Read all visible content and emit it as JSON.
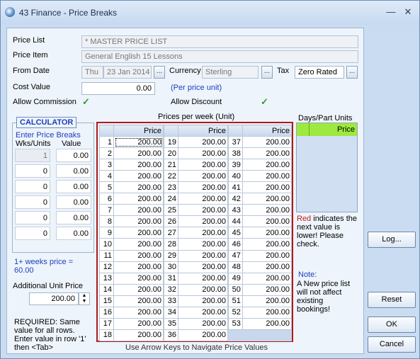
{
  "window": {
    "title": "43 Finance - Price Breaks"
  },
  "form": {
    "price_list_label": "Price List",
    "price_list_value": "* MASTER PRICE LIST",
    "price_item_label": "Price Item",
    "price_item_value": "General English 15 Lessons",
    "from_date_label": "From Date",
    "from_date_day": "Thu",
    "from_date_value": "23 Jan 2014",
    "currency_label": "Currency",
    "currency_value": "Sterling",
    "tax_label": "Tax",
    "tax_value": "Zero Rated",
    "cost_value_label": "Cost Value",
    "cost_value": "0.00",
    "cost_value_unit": "(Per price unit)",
    "allow_commission_label": "Allow Commission",
    "allow_discount_label": "Allow Discount",
    "ellipsis": "..."
  },
  "calculator": {
    "title": "CALCULATOR",
    "subtitle": "Enter Price Breaks",
    "col_weeks": "Wks/Units",
    "col_value": "Value",
    "rows": [
      {
        "weeks": "1",
        "value": "0.00"
      },
      {
        "weeks": "0",
        "value": "0.00"
      },
      {
        "weeks": "0",
        "value": "0.00"
      },
      {
        "weeks": "0",
        "value": "0.00"
      },
      {
        "weeks": "0",
        "value": "0.00"
      },
      {
        "weeks": "0",
        "value": "0.00"
      }
    ],
    "summary": "1+ weeks price = 60.00",
    "additional_unit_label": "Additional Unit Price",
    "additional_unit_value": "200.00",
    "required_text": "REQUIRED: Same value for all rows.  Enter value in row '1' then <Tab>"
  },
  "prices": {
    "title": "Prices per week (Unit)",
    "col_header": "Price",
    "hint": "Use Arrow Keys to Navigate Price Values",
    "col1": [
      {
        "n": "1",
        "v": "200.00"
      },
      {
        "n": "2",
        "v": "200.00"
      },
      {
        "n": "3",
        "v": "200.00"
      },
      {
        "n": "4",
        "v": "200.00"
      },
      {
        "n": "5",
        "v": "200.00"
      },
      {
        "n": "6",
        "v": "200.00"
      },
      {
        "n": "7",
        "v": "200.00"
      },
      {
        "n": "8",
        "v": "200.00"
      },
      {
        "n": "9",
        "v": "200.00"
      },
      {
        "n": "10",
        "v": "200.00"
      },
      {
        "n": "11",
        "v": "200.00"
      },
      {
        "n": "12",
        "v": "200.00"
      },
      {
        "n": "13",
        "v": "200.00"
      },
      {
        "n": "14",
        "v": "200.00"
      },
      {
        "n": "15",
        "v": "200.00"
      },
      {
        "n": "16",
        "v": "200.00"
      },
      {
        "n": "17",
        "v": "200.00"
      },
      {
        "n": "18",
        "v": "200.00"
      }
    ],
    "col2": [
      {
        "n": "19",
        "v": "200.00"
      },
      {
        "n": "20",
        "v": "200.00"
      },
      {
        "n": "21",
        "v": "200.00"
      },
      {
        "n": "22",
        "v": "200.00"
      },
      {
        "n": "23",
        "v": "200.00"
      },
      {
        "n": "24",
        "v": "200.00"
      },
      {
        "n": "25",
        "v": "200.00"
      },
      {
        "n": "26",
        "v": "200.00"
      },
      {
        "n": "27",
        "v": "200.00"
      },
      {
        "n": "28",
        "v": "200.00"
      },
      {
        "n": "29",
        "v": "200.00"
      },
      {
        "n": "30",
        "v": "200.00"
      },
      {
        "n": "31",
        "v": "200.00"
      },
      {
        "n": "32",
        "v": "200.00"
      },
      {
        "n": "33",
        "v": "200.00"
      },
      {
        "n": "34",
        "v": "200.00"
      },
      {
        "n": "35",
        "v": "200.00"
      },
      {
        "n": "36",
        "v": "200.00"
      }
    ],
    "col3": [
      {
        "n": "37",
        "v": "200.00"
      },
      {
        "n": "38",
        "v": "200.00"
      },
      {
        "n": "39",
        "v": "200.00"
      },
      {
        "n": "40",
        "v": "200.00"
      },
      {
        "n": "41",
        "v": "200.00"
      },
      {
        "n": "42",
        "v": "200.00"
      },
      {
        "n": "43",
        "v": "200.00"
      },
      {
        "n": "44",
        "v": "200.00"
      },
      {
        "n": "45",
        "v": "200.00"
      },
      {
        "n": "46",
        "v": "200.00"
      },
      {
        "n": "47",
        "v": "200.00"
      },
      {
        "n": "48",
        "v": "200.00"
      },
      {
        "n": "49",
        "v": "200.00"
      },
      {
        "n": "50",
        "v": "200.00"
      },
      {
        "n": "51",
        "v": "200.00"
      },
      {
        "n": "52",
        "v": "200.00"
      },
      {
        "n": "53",
        "v": "200.00"
      }
    ]
  },
  "days": {
    "title": "Days/Part Units",
    "col_header": "Price",
    "red_word": "Red",
    "red_note": " indicates the next value is lower!  Please check.",
    "note_title": "Note:",
    "note_text": "A New price list will not affect existing bookings!"
  },
  "buttons": {
    "log": "Log...",
    "reset": "Reset",
    "ok": "OK",
    "cancel": "Cancel"
  },
  "colors": {
    "accent_blue": "#1a3fbf",
    "grid_border_red": "#b01a1a",
    "days_header_green": "#9ee93d"
  }
}
